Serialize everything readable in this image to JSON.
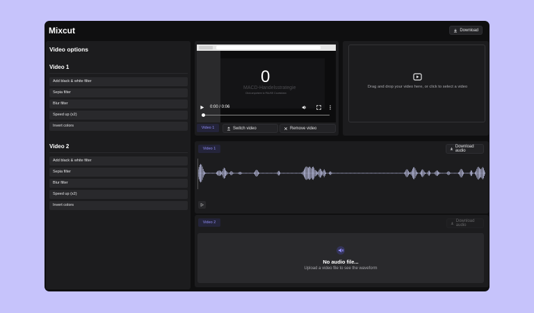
{
  "app": {
    "title": "Mixcut",
    "download_label": "Download"
  },
  "sidebar": {
    "heading": "Video options",
    "sections": [
      {
        "title": "Video 1",
        "options": [
          "Add black & white filter",
          "Sepia filter",
          "Blur filter",
          "Speed up (x2)",
          "Invert colors"
        ]
      },
      {
        "title": "Video 2",
        "options": [
          "Add black & white filter",
          "Sepia filter",
          "Blur filter",
          "Speed up (x2)",
          "Invert colors"
        ]
      }
    ]
  },
  "player": {
    "overlay_number": "0",
    "overlay_title": "MACD-Handelsstrategie",
    "overlay_subtitle": "Click anywhere to PAUSE Countdown",
    "time": "0:00 / 0:06",
    "progress": 0
  },
  "video1_controls": {
    "tab": "Video 1",
    "switch_label": "Switch video",
    "remove_label": "Remove video"
  },
  "dropzone": {
    "text": "Drag and drop your video here, or click to select a video"
  },
  "audio1": {
    "tab": "Video 1",
    "download_label": "Download audio"
  },
  "audio2": {
    "tab": "Video 2",
    "download_label": "Download audio",
    "empty_title": "No audio file...",
    "empty_subtitle": "Upload a video file to see the waveform"
  },
  "colors": {
    "accent": "#8f8cf5",
    "background": "#c6c3fb",
    "panel": "#1c1c1e",
    "waveform": "#cfd2f7"
  },
  "icons": [
    "download-icon",
    "video-icon",
    "play-icon",
    "volume-icon",
    "fullscreen-icon",
    "more-icon",
    "upload-icon",
    "close-icon",
    "speaker-icon"
  ]
}
